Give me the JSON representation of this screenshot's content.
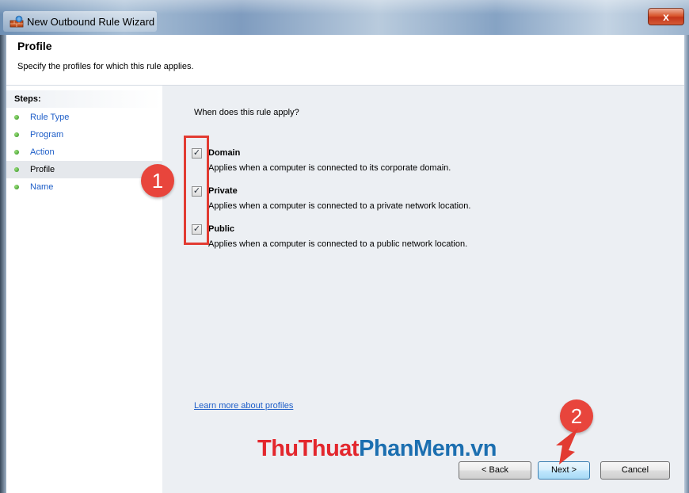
{
  "window": {
    "title": "New Outbound Rule Wizard",
    "close_label": "x"
  },
  "header": {
    "title": "Profile",
    "description": "Specify the profiles for which this rule applies."
  },
  "sidebar": {
    "steps_title": "Steps:",
    "items": [
      {
        "label": "Rule Type",
        "current": false
      },
      {
        "label": "Program",
        "current": false
      },
      {
        "label": "Action",
        "current": false
      },
      {
        "label": "Profile",
        "current": true
      },
      {
        "label": "Name",
        "current": false
      }
    ]
  },
  "main": {
    "question": "When does this rule apply?",
    "options": [
      {
        "label": "Domain",
        "description": "Applies when a computer is connected to its corporate domain.",
        "checked": true
      },
      {
        "label": "Private",
        "description": "Applies when a computer is connected to a private network location.",
        "checked": true
      },
      {
        "label": "Public",
        "description": "Applies when a computer is connected to a public network location.",
        "checked": true
      }
    ],
    "learn_more_link": "Learn more about profiles"
  },
  "buttons": {
    "back": "< Back",
    "next": "Next >",
    "cancel": "Cancel"
  },
  "annotations": {
    "badge_1": "1",
    "badge_2": "2",
    "highlight_color": "#e23b32"
  },
  "watermark": {
    "part_1": "ThuThuat",
    "part_2": "PhanMem",
    "part_3": ".vn"
  },
  "colors": {
    "link": "#1e5ec8",
    "badge": "#e8453c",
    "content_bg": "#eceff3"
  }
}
